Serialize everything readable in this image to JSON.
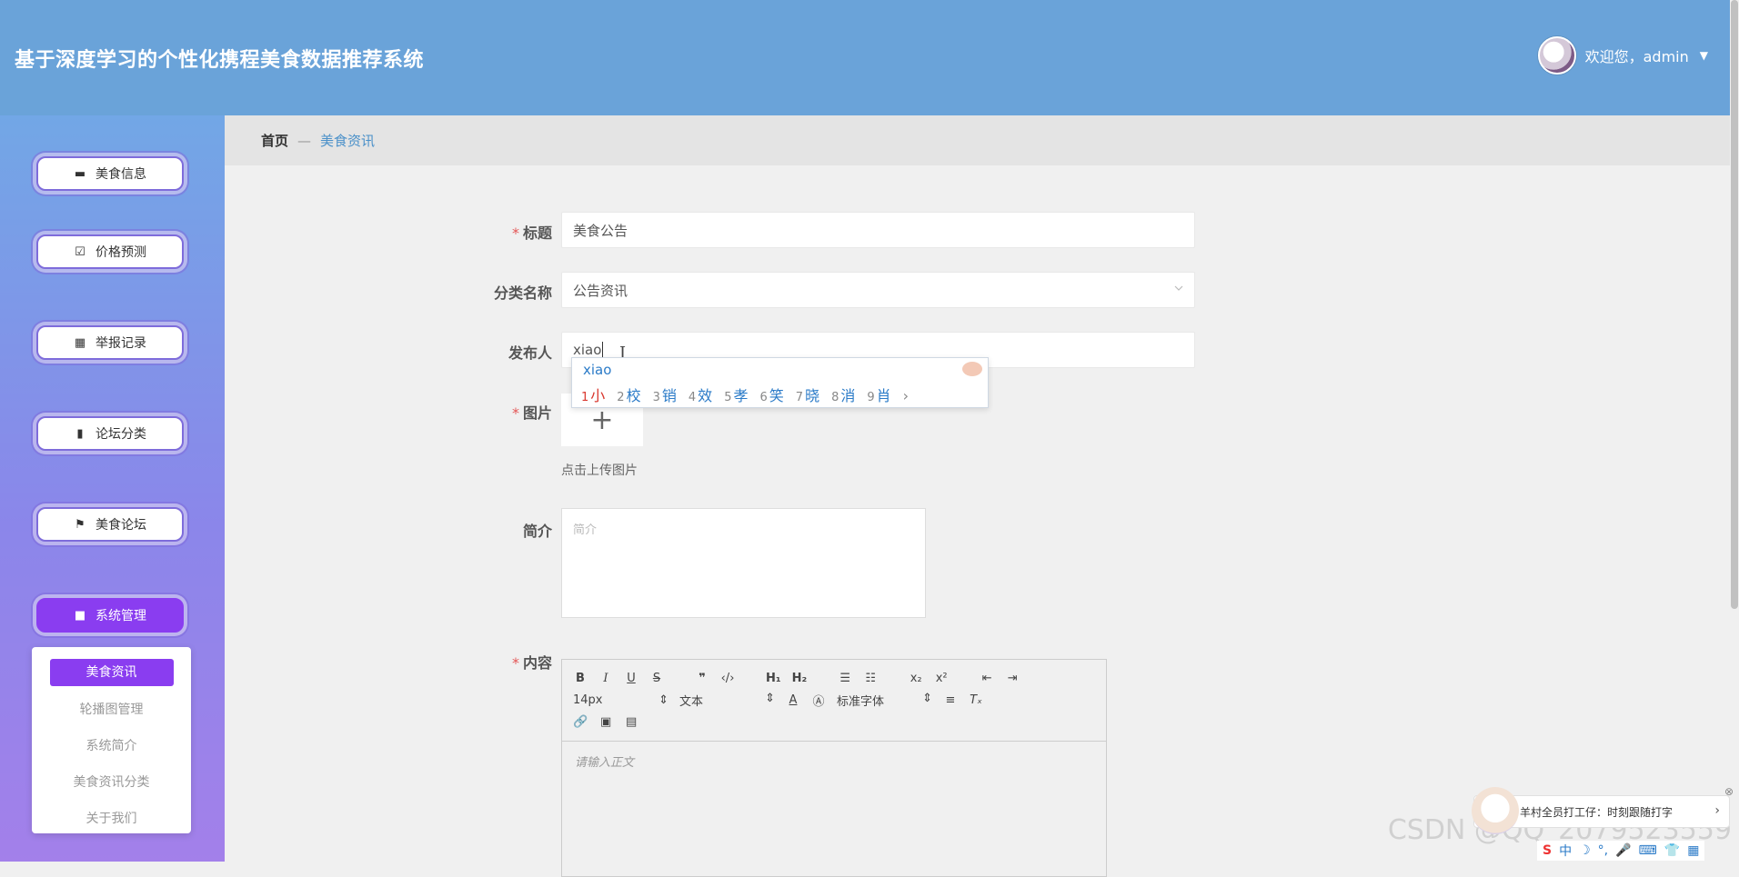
{
  "header": {
    "title": "基于深度学习的个性化携程美食数据推荐系统",
    "welcome": "欢迎您，admin"
  },
  "sidebar": {
    "items": [
      {
        "label": "美食信息",
        "icon": "list-icon"
      },
      {
        "label": "价格预测",
        "icon": "clipboard-check-icon"
      },
      {
        "label": "举报记录",
        "icon": "grid-icon"
      },
      {
        "label": "论坛分类",
        "icon": "bar-chart-icon"
      },
      {
        "label": "美食论坛",
        "icon": "flag-icon"
      },
      {
        "label": "系统管理",
        "icon": "folder-icon"
      }
    ],
    "submenu": [
      "美食资讯",
      "轮播图管理",
      "系统简介",
      "美食资讯分类",
      "关于我们"
    ]
  },
  "breadcrumb": {
    "home": "首页",
    "separator": "—",
    "current": "美食资讯"
  },
  "form": {
    "title_label": "标题",
    "title_value": "美食公告",
    "category_label": "分类名称",
    "category_value": "公告资讯",
    "publisher_label": "发布人",
    "publisher_value": "xiao",
    "image_label": "图片",
    "upload_hint": "点击上传图片",
    "intro_label": "简介",
    "intro_placeholder": "简介",
    "content_label": "内容",
    "required_mark": "*",
    "upload_plus": "+"
  },
  "ime": {
    "input": "xiao",
    "candidates": [
      {
        "n": "1",
        "c": "小"
      },
      {
        "n": "2",
        "c": "校"
      },
      {
        "n": "3",
        "c": "销"
      },
      {
        "n": "4",
        "c": "效"
      },
      {
        "n": "5",
        "c": "孝"
      },
      {
        "n": "6",
        "c": "笑"
      },
      {
        "n": "7",
        "c": "晓"
      },
      {
        "n": "8",
        "c": "消"
      },
      {
        "n": "9",
        "c": "肖"
      }
    ],
    "next": "›"
  },
  "editor": {
    "font_size": "14px",
    "block_type": "文本",
    "font_family": "标准字体",
    "placeholder": "请输入正文"
  },
  "overlay": {
    "watermark": "CSDN @QQ_2079523559",
    "tip": "羊村全员打工仔：时刻跟随打字",
    "tray_label": "中"
  },
  "colors": {
    "header": "#6aa3d9",
    "accent": "#8a3df0",
    "breadcrumb_current": "#4a90c9"
  }
}
